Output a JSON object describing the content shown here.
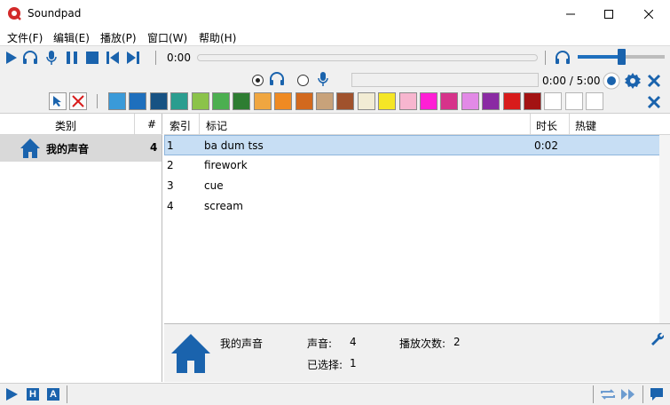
{
  "window": {
    "title": "Soundpad",
    "controls": [
      "minimize-icon",
      "maximize-icon",
      "close-icon"
    ]
  },
  "menu": [
    {
      "label": "文件(F)"
    },
    {
      "label": "编辑(E)"
    },
    {
      "label": "播放(P)"
    },
    {
      "label": "窗口(W)"
    },
    {
      "label": "帮助(H)"
    }
  ],
  "playback": {
    "current_time": "0:00",
    "progress": 0,
    "volume_fraction": 0.5,
    "icons": [
      "play-icon",
      "headphones-icon",
      "microphone-icon",
      "pause-icon",
      "stop-icon",
      "previous-icon",
      "next-icon"
    ]
  },
  "recording": {
    "output_selected": "headphones",
    "time": "0:00 / 5:00",
    "icons": [
      "record-icon",
      "settings-icon",
      "close-icon"
    ]
  },
  "colors": {
    "accent": "#1a63ad",
    "selection": "#c7def4",
    "swatches": [
      "#3a9ad9",
      "#1e6fbd",
      "#175283",
      "#2a9d8f",
      "#8bc34a",
      "#4caf50",
      "#2e7d32",
      "#f0a640",
      "#ef8a22",
      "#d2691e",
      "#c8a27a",
      "#a0522d",
      "#f2ecd4",
      "#f5e626",
      "#f7b6cf",
      "#ff1fd5",
      "#d6338a",
      "#e28ae6",
      "#8a2aa3",
      "#d81b1b",
      "#a31212",
      "#ffffff",
      "#ffffff",
      "#ffffff"
    ]
  },
  "categories": {
    "header_label": "类别",
    "header_count": "#",
    "items": [
      {
        "name": "我的声音",
        "count": "4",
        "icon": "home-icon"
      }
    ]
  },
  "sounds": {
    "columns": [
      "索引",
      "标记",
      "时长",
      "热键"
    ],
    "rows": [
      {
        "index": "1",
        "title": "ba dum tss",
        "duration": "0:02",
        "hotkey": ""
      },
      {
        "index": "2",
        "title": "firework",
        "duration": "",
        "hotkey": ""
      },
      {
        "index": "3",
        "title": "cue",
        "duration": "",
        "hotkey": ""
      },
      {
        "index": "4",
        "title": "scream",
        "duration": "",
        "hotkey": ""
      }
    ]
  },
  "info": {
    "category_name": "我的声音",
    "sounds_label": "声音:",
    "sounds_value": "4",
    "play_count_label": "播放次数:",
    "play_count_value": "2",
    "selected_label": "已选择:",
    "selected_value": "1",
    "icon": "home-icon"
  },
  "statusbar": {
    "left_buttons": [
      "play-icon",
      "H",
      "A"
    ],
    "right_icons": [
      "repeat-icon",
      "fast-forward-icon",
      "chat-icon"
    ]
  }
}
